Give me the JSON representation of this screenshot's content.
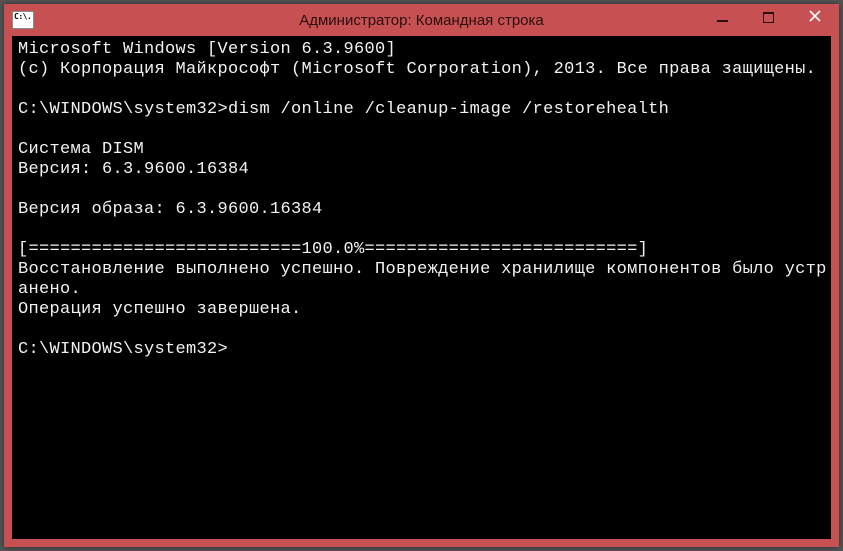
{
  "window": {
    "title": "Администратор: Командная строка",
    "sysicon_text": "C:\\."
  },
  "terminal": {
    "line1": "Microsoft Windows [Version 6.3.9600]",
    "line2": "(c) Корпорация Майкрософт (Microsoft Corporation), 2013. Все права защищены.",
    "blank1": "",
    "prompt1_path": "C:\\WINDOWS\\system32>",
    "prompt1_cmd": "dism /online /cleanup-image /restorehealth",
    "blank2": "",
    "dism_hdr": "Cистема DISM",
    "dism_ver": "Версия: 6.3.9600.16384",
    "blank3": "",
    "img_ver": "Версия образа: 6.3.9600.16384",
    "blank4": "",
    "progress": "[==========================100.0%==========================]",
    "restore_msg": "Восстановление выполнено успешно. Повреждение хранилище компонентов было устранено.",
    "op_msg": "Операция успешно завершена.",
    "blank5": "",
    "prompt2_path": "C:\\WINDOWS\\system32>",
    "prompt2_cmd": ""
  }
}
